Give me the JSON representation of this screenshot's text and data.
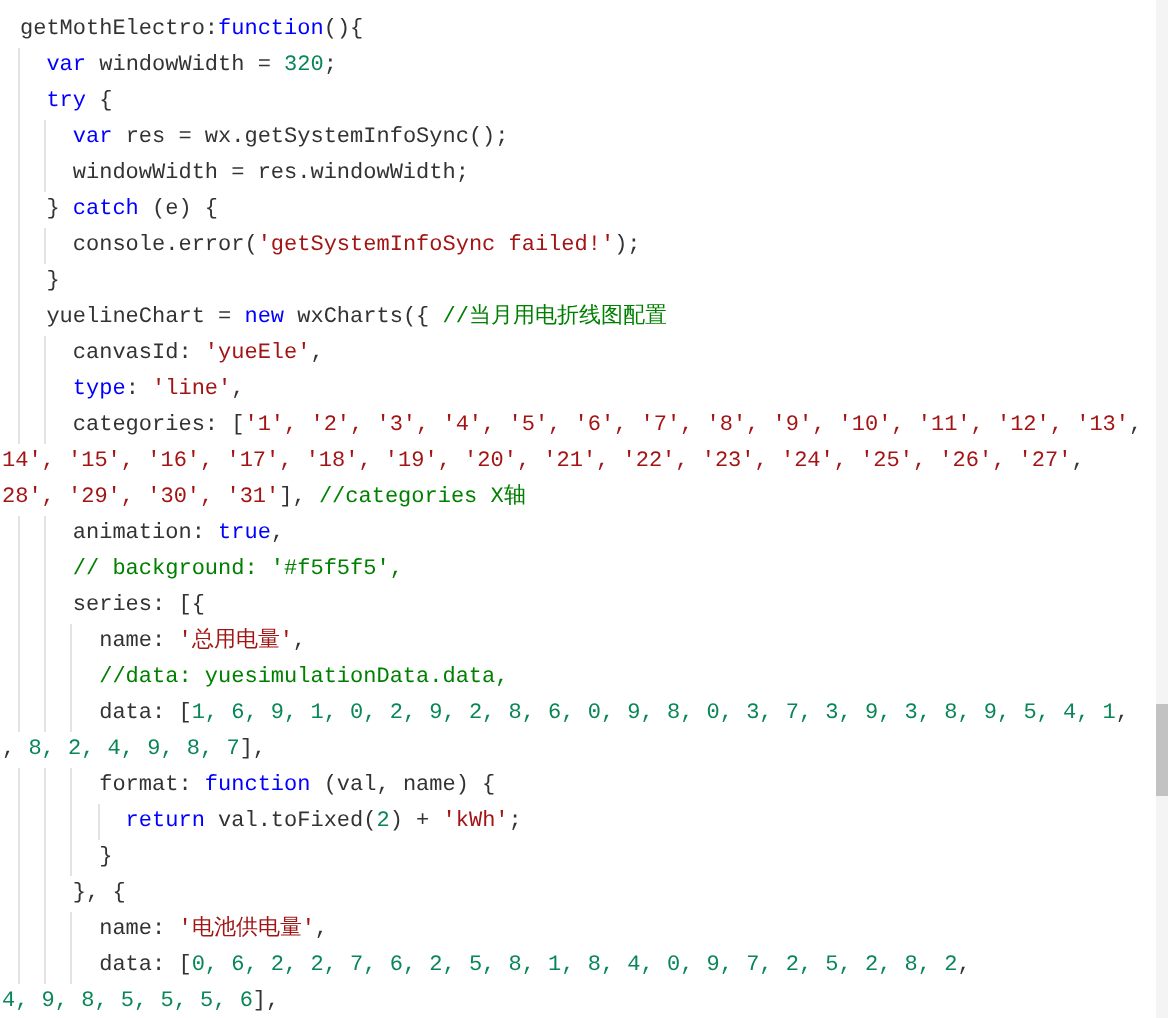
{
  "editor": {
    "lines": [
      {
        "kind": "code",
        "tokens": [
          {
            "kind": "plain",
            "text": "getMothElectro:"
          },
          {
            "kind": "keyword",
            "text": "function"
          },
          {
            "kind": "plain",
            "text": "(){"
          }
        ]
      },
      {
        "kind": "code",
        "tokens": [
          {
            "kind": "keyword",
            "text": "  var"
          },
          {
            "kind": "plain",
            "text": " windowWidth = "
          },
          {
            "kind": "number",
            "text": "320"
          },
          {
            "kind": "plain",
            "text": ";"
          }
        ]
      },
      {
        "kind": "code",
        "tokens": [
          {
            "kind": "keyword",
            "text": "  try"
          },
          {
            "kind": "plain",
            "text": " {"
          }
        ]
      },
      {
        "kind": "code",
        "tokens": [
          {
            "kind": "keyword",
            "text": "    var"
          },
          {
            "kind": "plain",
            "text": " res = wx.getSystemInfoSync();"
          }
        ]
      },
      {
        "kind": "code",
        "tokens": [
          {
            "kind": "plain",
            "text": "    windowWidth = res.windowWidth;"
          }
        ]
      },
      {
        "kind": "code",
        "tokens": [
          {
            "kind": "plain",
            "text": "  } "
          },
          {
            "kind": "keyword",
            "text": "catch"
          },
          {
            "kind": "plain",
            "text": " (e) {"
          }
        ]
      },
      {
        "kind": "code",
        "tokens": [
          {
            "kind": "plain",
            "text": "    console.error("
          },
          {
            "kind": "string",
            "text": "'getSystemInfoSync failed!'"
          },
          {
            "kind": "plain",
            "text": ");"
          }
        ]
      },
      {
        "kind": "code",
        "tokens": [
          {
            "kind": "plain",
            "text": "  }"
          }
        ]
      },
      {
        "kind": "code",
        "tokens": [
          {
            "kind": "plain",
            "text": "  yuelineChart = "
          },
          {
            "kind": "keyword",
            "text": "new"
          },
          {
            "kind": "plain",
            "text": " wxCharts({ "
          },
          {
            "kind": "comment",
            "text": "//当月用电折线图配置"
          }
        ]
      },
      {
        "kind": "code",
        "tokens": [
          {
            "kind": "plain",
            "text": "    canvasId: "
          },
          {
            "kind": "string",
            "text": "'yueEle'"
          },
          {
            "kind": "plain",
            "text": ","
          }
        ]
      },
      {
        "kind": "code",
        "tokens": [
          {
            "kind": "keyword",
            "text": "    type"
          },
          {
            "kind": "plain",
            "text": ": "
          },
          {
            "kind": "string",
            "text": "'line'"
          },
          {
            "kind": "plain",
            "text": ","
          }
        ]
      },
      {
        "kind": "code",
        "tokens": [
          {
            "kind": "plain",
            "text": "    categories: ["
          },
          {
            "kind": "string",
            "text": "'1', '2', '3', '4', '5', '6', '7', '8', '9', '10', '11', '12', '13'"
          },
          {
            "kind": "plain",
            "text": ","
          }
        ]
      },
      {
        "kind": "wrap",
        "tokens": [
          {
            "kind": "string",
            "text": "14', '15', '16', '17', '18', '19', '20', '21', '22', '23', '24', '25', '26', '27'"
          },
          {
            "kind": "plain",
            "text": ","
          }
        ]
      },
      {
        "kind": "wrap",
        "tokens": [
          {
            "kind": "string",
            "text": "28', '29', '30', '31'"
          },
          {
            "kind": "plain",
            "text": "], "
          },
          {
            "kind": "comment",
            "text": "//categories X轴"
          }
        ]
      },
      {
        "kind": "code",
        "tokens": [
          {
            "kind": "plain",
            "text": "    animation: "
          },
          {
            "kind": "keyword",
            "text": "true"
          },
          {
            "kind": "plain",
            "text": ","
          }
        ]
      },
      {
        "kind": "code",
        "tokens": [
          {
            "kind": "comment",
            "text": "    // background: '#f5f5f5',"
          }
        ]
      },
      {
        "kind": "code",
        "tokens": [
          {
            "kind": "plain",
            "text": "    series: [{"
          }
        ]
      },
      {
        "kind": "code",
        "tokens": [
          {
            "kind": "plain",
            "text": "      name: "
          },
          {
            "kind": "string",
            "text": "'总用电量'"
          },
          {
            "kind": "plain",
            "text": ","
          }
        ]
      },
      {
        "kind": "code",
        "tokens": [
          {
            "kind": "comment",
            "text": "      //data: yuesimulationData.data,"
          }
        ]
      },
      {
        "kind": "code",
        "tokens": [
          {
            "kind": "plain",
            "text": "      data: ["
          },
          {
            "kind": "number",
            "text": "1, 6, 9, 1, 0, 2, 9, 2, 8, 6, 0, 9, 8, 0, 3, 7, 3, 9, 3, 8, 9, 5, 4, 1"
          },
          {
            "kind": "plain",
            "text": ","
          }
        ]
      },
      {
        "kind": "wrap",
        "tokens": [
          {
            "kind": "plain",
            "text": ", "
          },
          {
            "kind": "number",
            "text": "8, 2, 4, 9, 8, 7"
          },
          {
            "kind": "plain",
            "text": "],"
          }
        ]
      },
      {
        "kind": "code",
        "tokens": [
          {
            "kind": "plain",
            "text": "      format: "
          },
          {
            "kind": "keyword",
            "text": "function"
          },
          {
            "kind": "plain",
            "text": " (val, name) {"
          }
        ]
      },
      {
        "kind": "code",
        "tokens": [
          {
            "kind": "keyword",
            "text": "        return"
          },
          {
            "kind": "plain",
            "text": " val.toFixed("
          },
          {
            "kind": "number",
            "text": "2"
          },
          {
            "kind": "plain",
            "text": ") + "
          },
          {
            "kind": "string",
            "text": "'kWh'"
          },
          {
            "kind": "plain",
            "text": ";"
          }
        ]
      },
      {
        "kind": "code",
        "tokens": [
          {
            "kind": "plain",
            "text": "      }"
          }
        ]
      },
      {
        "kind": "code",
        "tokens": [
          {
            "kind": "plain",
            "text": "    }, {"
          }
        ]
      },
      {
        "kind": "code",
        "tokens": [
          {
            "kind": "plain",
            "text": "      name: "
          },
          {
            "kind": "string",
            "text": "'电池供电量'"
          },
          {
            "kind": "plain",
            "text": ","
          }
        ]
      },
      {
        "kind": "code",
        "tokens": [
          {
            "kind": "plain",
            "text": "      data: ["
          },
          {
            "kind": "number",
            "text": "0, 6, 2, 2, 7, 6, 2, 5, 8, 1, 8, 4, 0, 9, 7, 2, 5, 2, 8, 2"
          },
          {
            "kind": "plain",
            "text": ","
          }
        ]
      },
      {
        "kind": "wrap",
        "tokens": [
          {
            "kind": "number",
            "text": "4, 9, 8, 5, 5, 5, 6"
          },
          {
            "kind": "plain",
            "text": "],"
          }
        ]
      }
    ]
  }
}
